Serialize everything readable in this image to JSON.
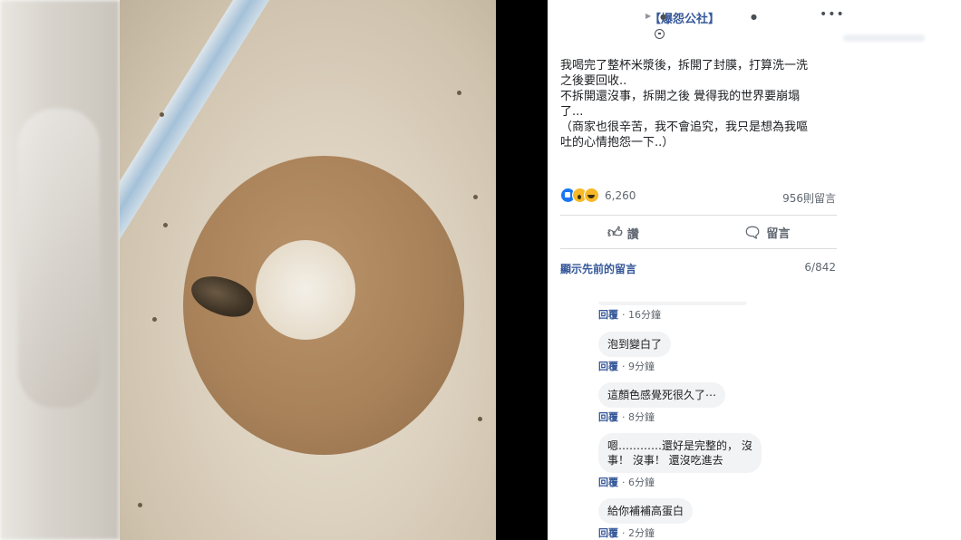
{
  "post": {
    "page_name": "【爆怨公社】",
    "more_label": "•••",
    "text": [
      "我喝完了整杯米漿後，拆開了封膜，打算洗一洗\n之後要回收..",
      "不拆開還沒事，拆開之後 覺得我的世界要崩塌\n了...",
      "（商家也很辛苦，我不會追究，我只是想為我嘔\n吐的心情抱怨一下..）"
    ],
    "reaction_count": "6,260",
    "comment_count": "956則留言",
    "like_label": "讚",
    "comment_label": "留言",
    "view_previous": "顯示先前的留言",
    "pagination": "6/842"
  },
  "comments": [
    {
      "text": "",
      "reply": "回覆",
      "time": "16分鐘"
    },
    {
      "text": "泡到變白了",
      "reply": "回覆",
      "time": "9分鐘"
    },
    {
      "text": "這顏色感覺死很久了⋯",
      "reply": "回覆",
      "time": "8分鐘"
    },
    {
      "text": "嗯…………還好是完整的， 沒\n事！ 沒事！ 還沒吃進去",
      "reply": "回覆",
      "time": "6分鐘"
    },
    {
      "text": "給你補補高蛋白",
      "reply": "回覆",
      "time": "2分鐘"
    }
  ],
  "colors": {
    "link": "#365899",
    "text": "#1c1e21",
    "muted": "#606770",
    "bubble": "#f2f3f5",
    "photo_bg": "#000000"
  },
  "icons": [
    "more-icon",
    "globe-icon",
    "like-icon",
    "comment-icon",
    "like-reaction-icon",
    "wow-reaction-icon",
    "haha-reaction-icon"
  ]
}
